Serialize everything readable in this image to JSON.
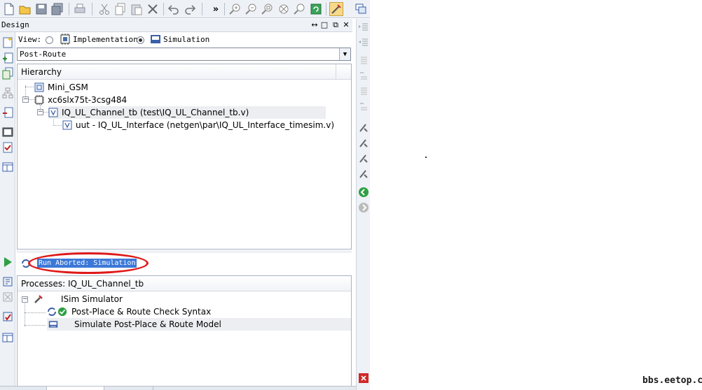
{
  "toolbar": {
    "buttons": [
      "new-file",
      "open-file",
      "save",
      "save-all",
      "print",
      "cut",
      "copy",
      "paste",
      "delete",
      "undo",
      "redo",
      "more",
      "zoom-in",
      "zoom-out",
      "zoom-fit",
      "zoom-full",
      "zoom-area",
      "refresh",
      "design-goals"
    ],
    "overflow_label": "»"
  },
  "design": {
    "title": "Design",
    "view_label": "View:",
    "view_options": [
      "Implementation",
      "Simulation"
    ],
    "selected_view": "Simulation",
    "route_select": "Post-Route",
    "hierarchy_header": "Hierarchy",
    "tree": [
      {
        "label": "Mini_GSM",
        "icon": "project-icon"
      },
      {
        "label": "xc6slx75t-3csg484",
        "icon": "chip-icon"
      },
      {
        "label": "IQ_UL_Channel_tb (test\\IQ_UL_Channel_tb.v)",
        "icon": "verilog-file-icon"
      },
      {
        "label": "uut - IQ_UL_Interface (netgen\\par\\IQ_UL_Interface_timesim.v)",
        "icon": "verilog-file-icon"
      }
    ]
  },
  "status": {
    "message": "Run Aborted: Simulation"
  },
  "processes": {
    "header": "Processes: IQ_UL_Channel_tb",
    "items": [
      {
        "label": "ISim Simulator",
        "icon": "tools-icon"
      },
      {
        "label": "Post-Place & Route Check Syntax",
        "icon": "check-ok-icon"
      },
      {
        "label": "Simulate Post-Place & Route Model",
        "icon": "isim-icon"
      }
    ]
  },
  "watermark": "bbs.eetop.cn",
  "colors": {
    "accent": "#3c78d8",
    "annotation": "#e01818",
    "panel": "#eef1f6"
  }
}
